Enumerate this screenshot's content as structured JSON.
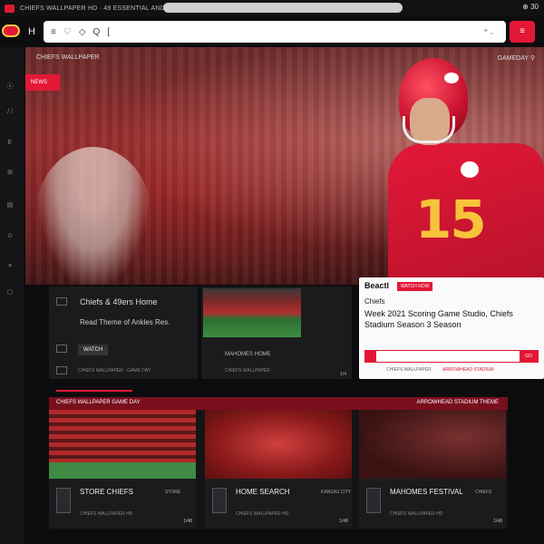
{
  "browser": {
    "tab_title": "CHIEFS WALLPAPER HD · 49 ESSENTIAL AND RESOURCES",
    "right_status": "⊕ 30"
  },
  "header": {
    "label": "H",
    "search_items": [
      "≡",
      "♡",
      "◇",
      "Q",
      "["
    ],
    "search_clear": "⌖ ⌄",
    "menu_label": "≡"
  },
  "sidebar": {
    "items": [
      "ⓔ",
      "/ /",
      "E",
      "⊞",
      "▤",
      "⊙",
      "≡",
      "▢"
    ]
  },
  "hero": {
    "top_left": "CHIEFS WALLPAPER",
    "top_right": "GAMEDAY ⚲",
    "badge": "NEWS",
    "jersey_number": "15"
  },
  "feature": {
    "title": "Chiefs & 49ers Home",
    "subtitle": "Read Theme of Ankles Res.",
    "cta": "WATCH",
    "meta": "CHIEFS WALLPAPER · GAME DAY"
  },
  "stadium": {
    "caption": "MAHOMES HOME",
    "caption2": "CHIEFS WALLPAPER",
    "count": "1/4"
  },
  "popup": {
    "heading": "Beactl",
    "tag": "WATCH NOW",
    "label": "Chiefs",
    "text": "Week 2021 Scoring Game Studio, Chiefs Stadium Season 3 Season",
    "bar_right": "GO",
    "foot_left": "CHIEFS WALLPAPER",
    "foot_right": "ARROWHEAD STADIUM"
  },
  "section": {
    "header_left": "CHIEFS WALLPAPER GAME DAY",
    "header_right": "ARROWHEAD STADIUM THEME",
    "cards": [
      {
        "label": "STORE CHIEFS",
        "duration": "STORE",
        "desc": "CHIEFS WALLPAPER HD",
        "count": "1/48"
      },
      {
        "label": "HOME SEARCH",
        "duration": "KANSAS CITY",
        "desc": "CHIEFS WALLPAPER HD",
        "count": "1/48"
      },
      {
        "label": "MAHOMES FESTIVAL",
        "duration": "CHIEFS",
        "desc": "CHIEFS WALLPAPER HD",
        "count": "1/48"
      }
    ]
  },
  "colors": {
    "brand_red": "#e31837",
    "brand_gold": "#f6c43a"
  }
}
